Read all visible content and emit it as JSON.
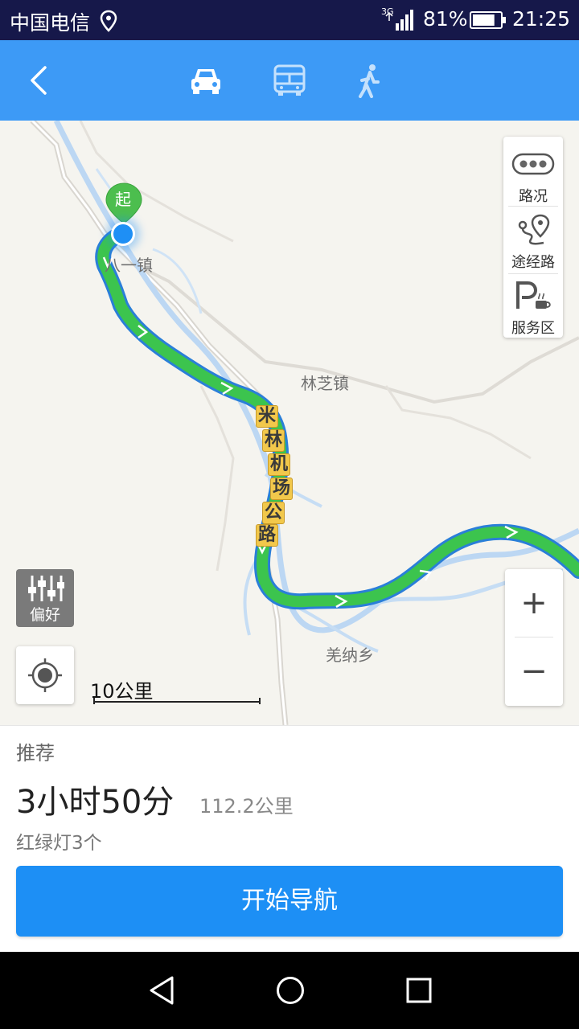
{
  "status_bar": {
    "carrier": "中国电信",
    "network": "3G",
    "battery_percent": "81%",
    "battery_level": 0.81,
    "time": "21:25"
  },
  "top_bar": {
    "modes": [
      "car-icon",
      "bus-icon",
      "walk-icon"
    ],
    "selected_mode": "car",
    "accent": "#3d9af6"
  },
  "map": {
    "places": {
      "bayi": "八一镇",
      "linzhi": "林芝镇",
      "qiangna": "羌纳乡"
    },
    "road_name_chars": [
      "米",
      "林",
      "机",
      "场",
      "公",
      "路"
    ],
    "start_marker": "起",
    "controls": {
      "traffic": "路况",
      "waypoint": "途经路",
      "service_area": "服务区"
    },
    "preference": "偏好",
    "scale": "10公里",
    "zoom_in": "+",
    "zoom_out": "−",
    "route_color": "#3cc44e",
    "route_outline": "#2a7fd8"
  },
  "route": {
    "tag": "推荐",
    "duration": "3小时50分",
    "distance": "112.2公里",
    "traffic_lights": "红绿灯3个",
    "start_button": "开始导航",
    "button_color": "#1d8ff5"
  }
}
